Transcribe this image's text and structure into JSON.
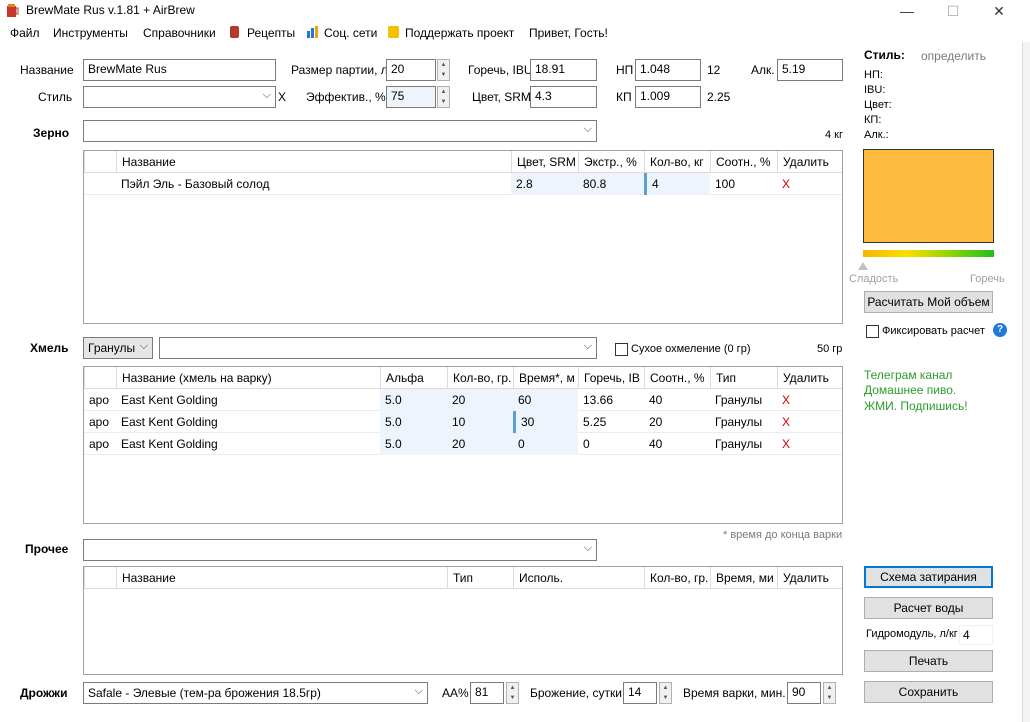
{
  "window": {
    "title": "BrewMate Rus v.1.81 + AirBrew",
    "min": "—",
    "max": "☐",
    "close": "✕"
  },
  "menu": [
    "Файл",
    "Инструменты",
    "Справочники",
    "Рецепты",
    "Соц. сети",
    "Поддержать проект",
    "Привет, Гость!"
  ],
  "recipe": {
    "name_label": "Название",
    "name_value": "BrewMate Rus",
    "style_label": "Стиль",
    "style_value": "",
    "style_clear": "X",
    "batch_label": "Размер партии, л",
    "batch_value": "20",
    "eff_label": "Эффектив., %",
    "eff_value": "75",
    "ibu_label": "Горечь, IBU",
    "ibu_value": "18.91",
    "srm_label": "Цвет, SRM",
    "srm_value": "4.3",
    "og_label": "НП",
    "og_value": "1.048",
    "og_plato": "12",
    "fg_label": "КП",
    "fg_value": "1.009",
    "fg_plato": "2.25",
    "abv_label": "Алк.",
    "abv_value": "5.19"
  },
  "grain": {
    "label": "Зерно",
    "total": "4 кг",
    "headers": [
      "Название",
      "Цвет, SRM",
      "Экстр., %",
      "Кол-во, кг",
      "Соотн., %",
      "Удалить"
    ],
    "rows": [
      {
        "name": "Пэйл Эль  -  Базовый солод",
        "srm": "2.8",
        "extract": "80.8",
        "qty": "4",
        "ratio": "100",
        "del": "X"
      }
    ]
  },
  "hops": {
    "label": "Хмель",
    "form": "Гранулы",
    "dry_hop": "Сухое охмеление (0 гр)",
    "total": "50 гр",
    "headers": [
      "Название (хмель на варку)",
      "Альфа",
      "Кол-во, гр.",
      "Время*, м",
      "Горечь, IB",
      "Соотн., %",
      "Тип",
      "Удалить"
    ],
    "rows": [
      {
        "use": "аро",
        "name": "East Kent Golding",
        "alpha": "5.0",
        "qty": "20",
        "time": "60",
        "ibu": "13.66",
        "ratio": "40",
        "type": "Гранулы",
        "del": "X"
      },
      {
        "use": "аро",
        "name": "East Kent Golding",
        "alpha": "5.0",
        "qty": "10",
        "time": "30",
        "ibu": "5.25",
        "ratio": "20",
        "type": "Гранулы",
        "del": "X"
      },
      {
        "use": "аро",
        "name": "East Kent Golding",
        "alpha": "5.0",
        "qty": "20",
        "time": "0",
        "ibu": "0",
        "ratio": "40",
        "type": "Гранулы",
        "del": "X"
      }
    ],
    "footnote": "* время до конца варки"
  },
  "other": {
    "label": "Прочее",
    "headers": [
      "Название",
      "Тип",
      "Исполь.",
      "Кол-во, гр.",
      "Время, ми",
      "Удалить"
    ]
  },
  "yeast": {
    "label": "Дрожжи",
    "value": "Safale  -  Элевые (тем-ра брожения 18.5гр)",
    "aa_label": "АА%",
    "aa_value": "81",
    "ferm_label": "Брожение, сутки",
    "ferm_value": "14",
    "boil_label": "Время варки, мин.",
    "boil_value": "90"
  },
  "side": {
    "style_title": "Стиль:",
    "style_link": "определить",
    "og": "НП:",
    "ibu": "IBU:",
    "color": "Цвет:",
    "fg": "КП:",
    "abv": "Алк.:",
    "swatch_color": "#ffbb3d",
    "sweet": "Сладость",
    "bitter": "Горечь",
    "calc_btn": "Расчитать Мой объем",
    "fix_label": "Фиксировать расчет",
    "help": "?",
    "promo1": "Телеграм канал",
    "promo2": "Домашнее пиво.",
    "promo3": "ЖМИ. Подпишись!",
    "mash_btn": "Схема затирания",
    "water_btn": "Расчет воды",
    "hydro_label": "Гидромодуль, л/кг",
    "hydro_value": "4",
    "print_btn": "Печать",
    "save_btn": "Сохранить"
  }
}
